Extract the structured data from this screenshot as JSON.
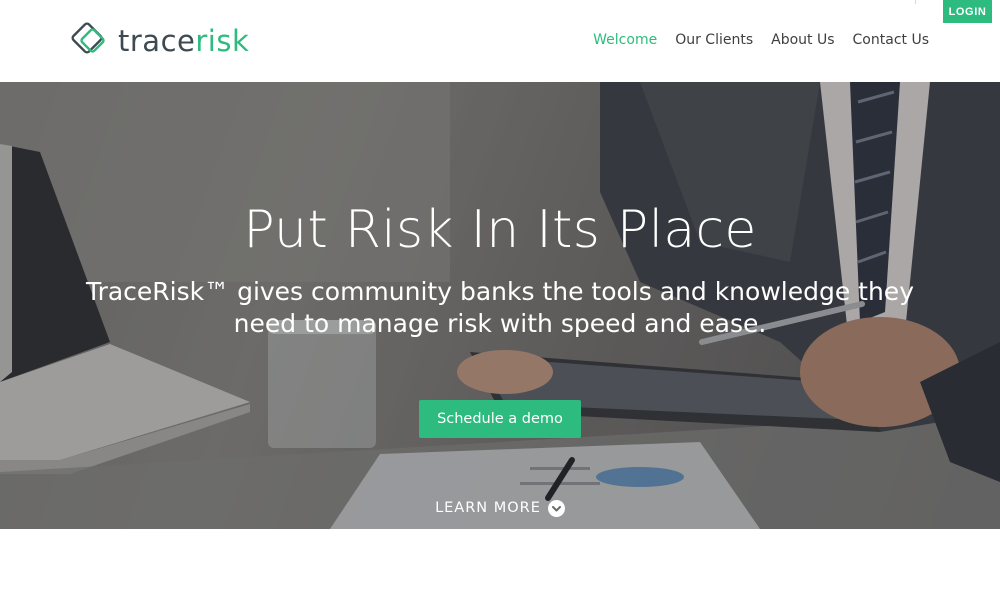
{
  "brand": {
    "name_part1": "trace",
    "name_part2": "risk",
    "colors": {
      "accent": "#2dbb7f",
      "dark": "#3d4a52"
    },
    "logo_icon": "diamond-logo-icon"
  },
  "nav": {
    "items": [
      {
        "label": "Welcome",
        "active": true
      },
      {
        "label": "Our Clients",
        "active": false
      },
      {
        "label": "About Us",
        "active": false
      },
      {
        "label": "Contact Us",
        "active": false
      }
    ],
    "login_label": "LOGIN"
  },
  "hero": {
    "title": "Put Risk In Its Place",
    "subtitle": "TraceRisk™ gives community banks the tools and knowledge they need to manage risk with speed and ease.",
    "cta_label": "Schedule a demo",
    "learn_more_label": "LEARN MORE",
    "learn_more_icon": "chevron-down-icon"
  }
}
